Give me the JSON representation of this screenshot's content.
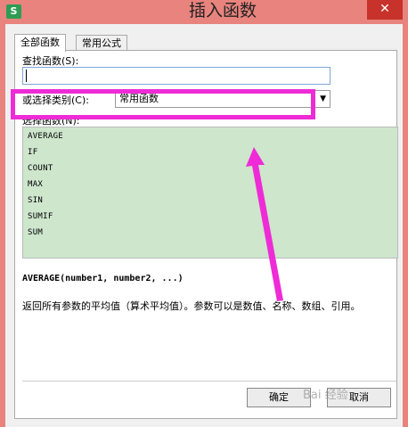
{
  "window": {
    "title": "插入函数",
    "app_icon_text": "S",
    "close_label": "✕"
  },
  "tabs": [
    {
      "label": "全部函数"
    },
    {
      "label": "常用公式"
    }
  ],
  "search": {
    "label": "查找函数(S):",
    "value": ""
  },
  "category": {
    "label": "或选择类别(C):",
    "selected": "常用函数"
  },
  "functions": {
    "label": "选择函数(N):",
    "items": [
      "AVERAGE",
      "IF",
      "COUNT",
      "MAX",
      "SIN",
      "SUMIF",
      "SUM"
    ]
  },
  "details": {
    "signature": "AVERAGE(number1, number2, ...)",
    "description": "返回所有参数的平均值（算术平均值）。参数可以是数值、名称、数组、引用。"
  },
  "buttons": {
    "ok": "确定",
    "cancel": "取消"
  },
  "annotation": {
    "highlight_color": "#ee2bd6"
  },
  "watermark": "Bai 经验"
}
